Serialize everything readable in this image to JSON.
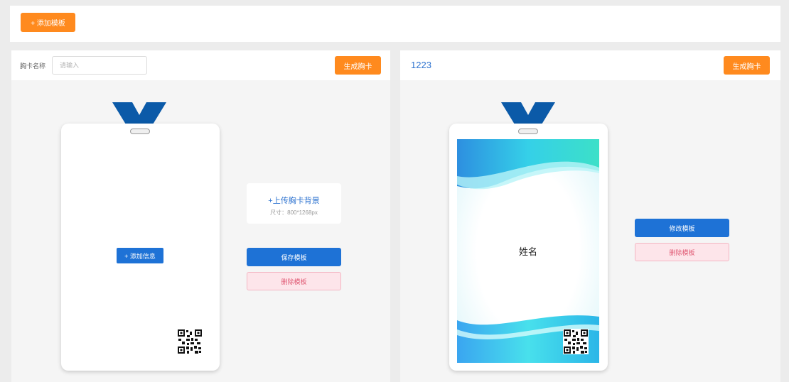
{
  "toolbar": {
    "add_template_label": "+ 添加模板"
  },
  "left_panel": {
    "name_label": "胸卡名称",
    "name_placeholder": "请输入",
    "name_value": "",
    "generate_label": "生成胸卡",
    "add_info_label": "+ 添加信息",
    "upload_title": "+上传胸卡背景",
    "upload_size": "尺寸：800*1268px",
    "save_label": "保存模板",
    "delete_label": "删除模板"
  },
  "right_panel": {
    "template_name": "1223",
    "generate_label": "生成胸卡",
    "card_name_field": "姓名",
    "edit_label": "修改模板",
    "delete_label": "删除模板"
  },
  "colors": {
    "accent_orange": "#ff8a1e",
    "primary_blue": "#1e72d6",
    "lanyard_blue": "#0b5aa8",
    "danger_pink_bg": "#fde5ea",
    "danger_pink_text": "#e05a74"
  },
  "icons": [
    "lanyard-icon",
    "qr-code-icon",
    "plus-icon"
  ]
}
